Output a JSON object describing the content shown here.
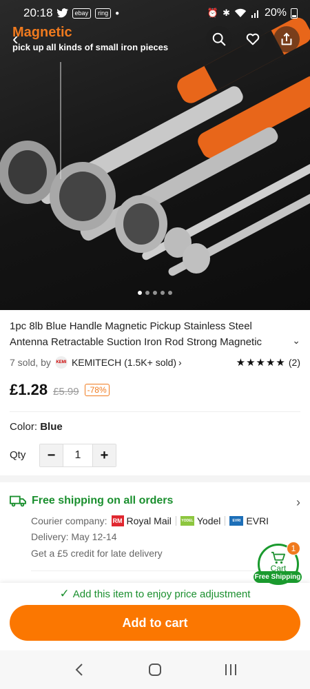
{
  "status_bar": {
    "time": "20:18",
    "notif_icons": [
      "twitter-icon",
      "ebay-icon",
      "ring-icon"
    ],
    "notif_mini1": "ebay",
    "notif_mini2": "ring",
    "battery": "20%"
  },
  "hero": {
    "title": "Magnetic",
    "subtitle": "pick up all kinds of small iron pieces",
    "dot_count": 5,
    "active_dot": 0
  },
  "product": {
    "title": "1pc 8lb Blue Handle Magnetic Pickup Stainless Steel Antenna Retractable Suction Iron Rod Strong Magnetic",
    "sold": "7 sold, by",
    "store_logo": "KEMI",
    "store": "KEMITECH (1.5K+ sold)",
    "stars": "★★★★★",
    "reviews": "(2)",
    "price": "£1.28",
    "original_price": "£5.99",
    "discount": "-78%",
    "color_label": "Color:",
    "color_value": "Blue",
    "qty_label": "Qty",
    "qty_value": "1",
    "minus": "−",
    "plus": "+"
  },
  "shipping": {
    "headline": "Free shipping on all orders",
    "courier_label": "Courier company:",
    "couriers": [
      {
        "name": "Royal Mail",
        "logo": "RM"
      },
      {
        "name": "Yodel",
        "logo": "YODEL"
      },
      {
        "name": "EVRI",
        "logo": "EVRI"
      }
    ],
    "delivery": "Delivery: May 12-14",
    "credit": "Get a £5 credit for late delivery"
  },
  "cart_float": {
    "label": "Cart",
    "badge": "1",
    "free_shipping": "Free Shipping"
  },
  "bottom": {
    "adjust_text": "Add this item to enjoy price adjustment",
    "add_to_cart": "Add to cart"
  },
  "colors": {
    "accent_orange": "#fb7701",
    "green": "#1a8f2e"
  }
}
